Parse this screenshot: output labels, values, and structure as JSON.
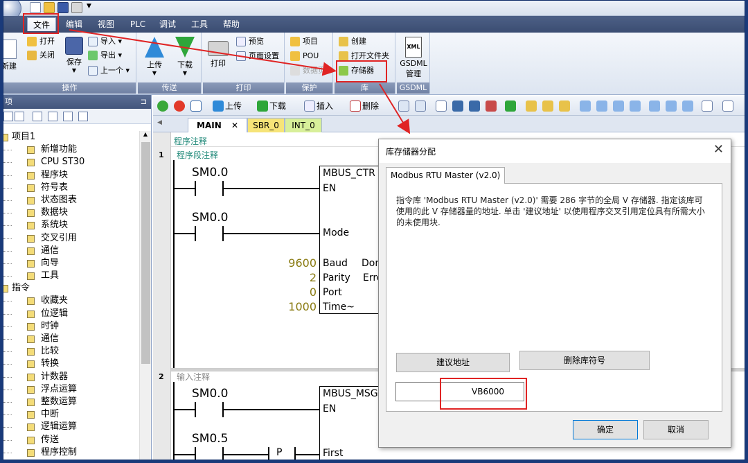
{
  "menu": {
    "items": [
      "文件",
      "编辑",
      "视图",
      "PLC",
      "调试",
      "工具",
      "帮助"
    ]
  },
  "ribbon": {
    "new_label": "新建",
    "open_label": "打开",
    "close_label": "关闭",
    "save_label": "保存",
    "import_label": "导入",
    "export_label": "导出",
    "previous_label": "上一个",
    "upload_label": "上传",
    "download_label": "下载",
    "print_label": "打印",
    "preview_label": "预览",
    "page_setup_label": "页面设置",
    "project_label": "项目",
    "pou_label": "POU",
    "data_page_label": "数据页",
    "create_label": "创建",
    "open_folder_label": "打开文件夹",
    "memory_label": "存储器",
    "gsdml_label": "GSDML",
    "gsdml_manage_label": "管理",
    "groups": {
      "operate": "操作",
      "transfer": "传送",
      "print": "打印",
      "protect": "保护",
      "library": "库",
      "gsdml": "GSDML"
    }
  },
  "left_panel": {
    "title": "项",
    "tree": [
      {
        "label": "项目1",
        "level": 0
      },
      {
        "label": "新增功能",
        "level": 1
      },
      {
        "label": "CPU ST30",
        "level": 1
      },
      {
        "label": "程序块",
        "level": 1
      },
      {
        "label": "符号表",
        "level": 1
      },
      {
        "label": "状态图表",
        "level": 1
      },
      {
        "label": "数据块",
        "level": 1
      },
      {
        "label": "系统块",
        "level": 1
      },
      {
        "label": "交叉引用",
        "level": 1
      },
      {
        "label": "通信",
        "level": 1
      },
      {
        "label": "向导",
        "level": 1
      },
      {
        "label": "工具",
        "level": 1
      },
      {
        "label": "指令",
        "level": 0
      },
      {
        "label": "收藏夹",
        "level": 1
      },
      {
        "label": "位逻辑",
        "level": 1
      },
      {
        "label": "时钟",
        "level": 1
      },
      {
        "label": "通信",
        "level": 1
      },
      {
        "label": "比较",
        "level": 1
      },
      {
        "label": "转换",
        "level": 1
      },
      {
        "label": "计数器",
        "level": 1
      },
      {
        "label": "浮点运算",
        "level": 1
      },
      {
        "label": "整数运算",
        "level": 1
      },
      {
        "label": "中断",
        "level": 1
      },
      {
        "label": "逻辑运算",
        "level": 1
      },
      {
        "label": "传送",
        "level": 1
      },
      {
        "label": "程序控制",
        "level": 1
      }
    ]
  },
  "editor_toolbar": {
    "upload": "上传",
    "download": "下载",
    "insert": "插入",
    "delete": "删除"
  },
  "tabs": {
    "main": "MAIN",
    "sbr": "SBR_0",
    "int": "INT_0"
  },
  "editor": {
    "program_comment": "程序注释",
    "net1_no": "1",
    "net1_comment": "程序段注释",
    "net2_no": "2",
    "net2_comment": "输入注释",
    "contact1": "SM0.0",
    "contact2": "SM0.0",
    "contact3": "SM0.0",
    "contact4": "SM0.5",
    "p_contact": "P",
    "box1_title": "MBUS_CTR",
    "box2_title": "MBUS_MSG",
    "pins": {
      "en": "EN",
      "mode": "Mode",
      "baud": "Baud",
      "parity": "Parity",
      "port": "Port",
      "timeout": "Time~",
      "done": "Don",
      "error": "Erro",
      "en2": "EN",
      "first": "First"
    },
    "values": {
      "baud": "9600",
      "parity": "2",
      "port": "0",
      "timeout": "1000"
    }
  },
  "dialog": {
    "title": "库存储器分配",
    "tab": "Modbus RTU Master (v2.0)",
    "message": "指令库 'Modbus RTU Master (v2.0)' 需要 286 字节的全局 V 存储器. 指定该库可使用的此 V 存储器量的地址. 单击 '建议地址' 以使用程序交叉引用定位具有所需大小的未使用块.",
    "suggest_button": "建议地址",
    "delete_button": "删除库符号",
    "address_value": "VB6000",
    "ok_button": "确定",
    "cancel_button": "取消"
  },
  "colors": {
    "highlight": "#e02424",
    "menubar": "#42557c",
    "value_text": "#8a7b12",
    "comment_text": "#228a7a"
  }
}
